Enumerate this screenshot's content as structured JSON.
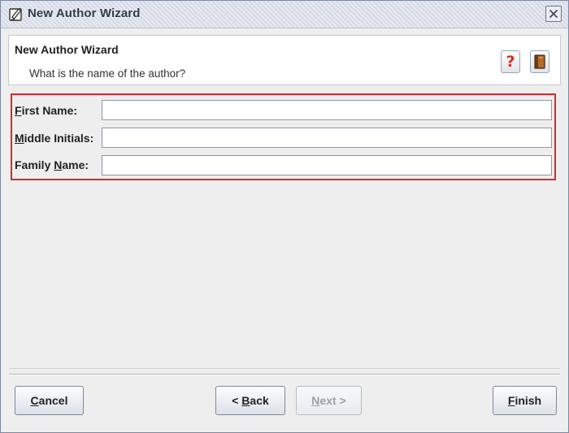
{
  "window": {
    "title": "New Author Wizard",
    "close_symbol": "X",
    "icon": "wizard-app-icon"
  },
  "header": {
    "title": "New Author Wizard",
    "subtitle": "What is the name of the author?",
    "help_icon": "help-question-icon",
    "help_symbol": "?",
    "book_icon": "book-icon"
  },
  "form": {
    "fields": [
      {
        "label_mnemonic": "F",
        "label_rest": "irst Name:",
        "value": ""
      },
      {
        "label_mnemonic": "M",
        "label_rest": "iddle Initials:",
        "value": ""
      },
      {
        "label_pre": "Family ",
        "label_mnemonic": "N",
        "label_rest": "ame:",
        "value": ""
      }
    ],
    "highlight_color": "#d9282c"
  },
  "buttons": {
    "cancel": {
      "mnemonic": "C",
      "rest": "ancel"
    },
    "back": {
      "pre": "< ",
      "mnemonic": "B",
      "rest": "ack"
    },
    "next": {
      "mnemonic": "N",
      "rest": "ext >",
      "enabled": false
    },
    "finish": {
      "mnemonic": "F",
      "rest": "inish"
    }
  }
}
